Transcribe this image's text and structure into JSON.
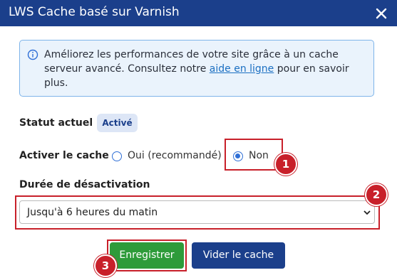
{
  "dialog": {
    "title": "LWS Cache basé sur Varnish"
  },
  "info": {
    "text_before_link": "Améliorez les performances de votre site grâce à un cache serveur avancé. Consultez notre ",
    "link_text": "aide en ligne",
    "text_after_link": " pour en savoir plus."
  },
  "status": {
    "label": "Statut actuel :",
    "badge": "Activé"
  },
  "enable_cache": {
    "label": "Activer le cache :",
    "options": [
      {
        "label": "Oui (recommandé)",
        "selected": false
      },
      {
        "label": "Non",
        "selected": true
      }
    ]
  },
  "duration": {
    "label": "Durée de désactivation",
    "selected": "Jusqu'à 6 heures du matin"
  },
  "buttons": {
    "save": "Enregistrer",
    "clear": "Vider le cache"
  },
  "markers": [
    "1",
    "2",
    "3"
  ],
  "colors": {
    "header": "#1b3f8b",
    "highlight": "#c8202a",
    "save_button": "#2e9b3a",
    "clear_button": "#1b3f8b",
    "info_background": "#eaf3fc"
  }
}
